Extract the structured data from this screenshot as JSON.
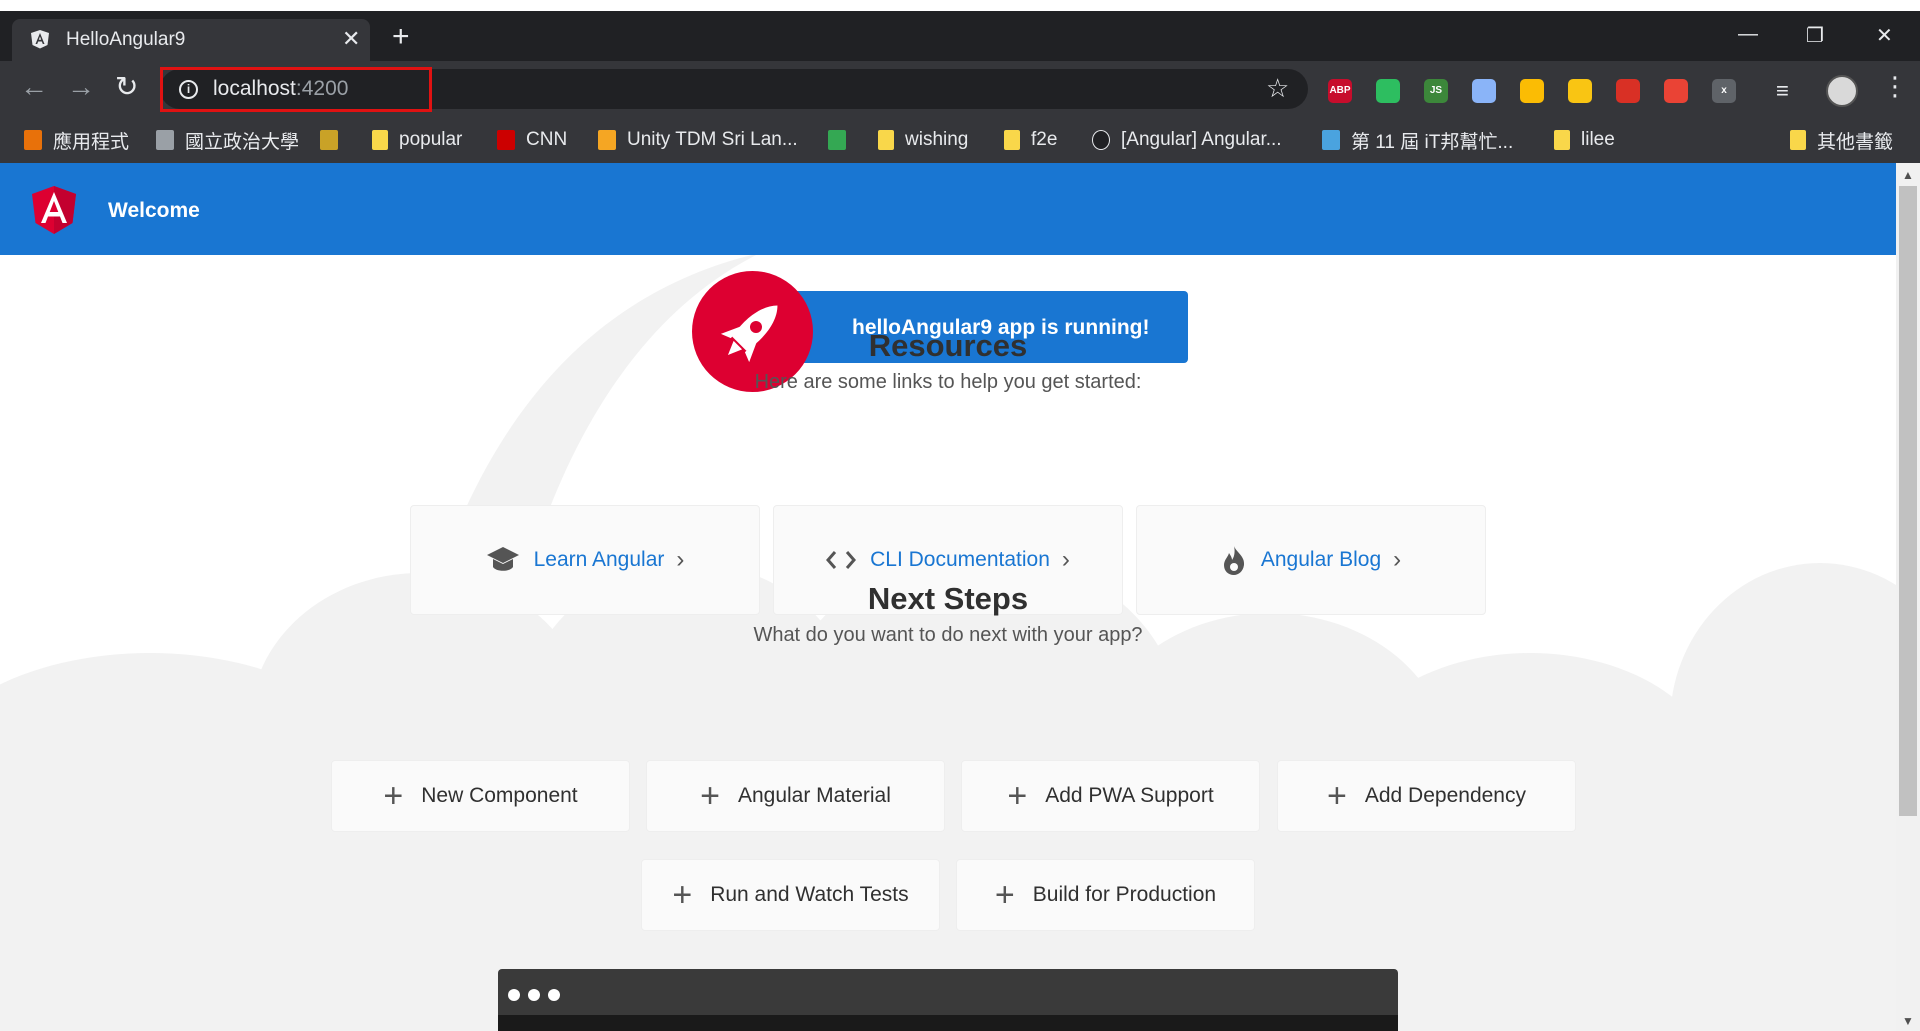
{
  "browser": {
    "tab_title": "HelloAngular9",
    "new_tab": "+",
    "url_host": "localhost",
    "url_port": ":4200",
    "bookmarks": [
      {
        "label": "應用程式",
        "icon": "apps-grid-icon"
      },
      {
        "label": "國立政治大學",
        "icon": "page-icon"
      },
      {
        "label": "",
        "icon": "wow-icon"
      },
      {
        "label": "popular",
        "icon": "folder-icon"
      },
      {
        "label": "CNN",
        "icon": "cnn-icon"
      },
      {
        "label": "Unity TDM Sri Lan...",
        "icon": "g-icon"
      },
      {
        "label": "",
        "icon": "drive-icon"
      },
      {
        "label": "wishing",
        "icon": "folder-icon"
      },
      {
        "label": "f2e",
        "icon": "folder-icon"
      },
      {
        "label": "[Angular] Angular...",
        "icon": "n-icon"
      },
      {
        "label": "第 11 屆 iT邦幫忙...",
        "icon": "ithome-icon"
      },
      {
        "label": "lilee",
        "icon": "folder-icon"
      },
      {
        "label": "其他書籤",
        "icon": "folder-icon"
      }
    ],
    "extensions": [
      {
        "name": "abp-icon",
        "text": "ABP",
        "color": "#c70d2c"
      },
      {
        "name": "evernote-icon",
        "text": "",
        "color": "#2dbe60"
      },
      {
        "name": "nodejs-icon",
        "text": "JS",
        "color": "#3c873a"
      },
      {
        "name": "ring-icon",
        "text": "",
        "color": "#8ab4f8"
      },
      {
        "name": "drive-ext-icon",
        "text": "",
        "color": "#fbbc04"
      },
      {
        "name": "crescent-icon",
        "text": "",
        "color": "#f9c513"
      },
      {
        "name": "book-icon",
        "text": "",
        "color": "#d93025"
      },
      {
        "name": "gift-icon",
        "text": "",
        "color": "#ea4335"
      },
      {
        "name": "x-ext-icon",
        "text": "x",
        "color": "#5f6368"
      }
    ]
  },
  "app": {
    "toolbar_title": "Welcome",
    "banner_text": "helloAngular9 app is running!",
    "resources_title": "Resources",
    "resources_subtitle": "Here are some links to help you get started:",
    "resources": [
      {
        "label": "Learn Angular",
        "icon": "graduation-cap-icon"
      },
      {
        "label": "CLI Documentation",
        "icon": "code-brackets-icon"
      },
      {
        "label": "Angular Blog",
        "icon": "flame-icon"
      }
    ],
    "next_title": "Next Steps",
    "next_subtitle": "What do you want to do next with your app?",
    "steps": [
      "New Component",
      "Angular Material",
      "Add PWA Support",
      "Add Dependency",
      "Run and Watch Tests",
      "Build for Production"
    ]
  }
}
